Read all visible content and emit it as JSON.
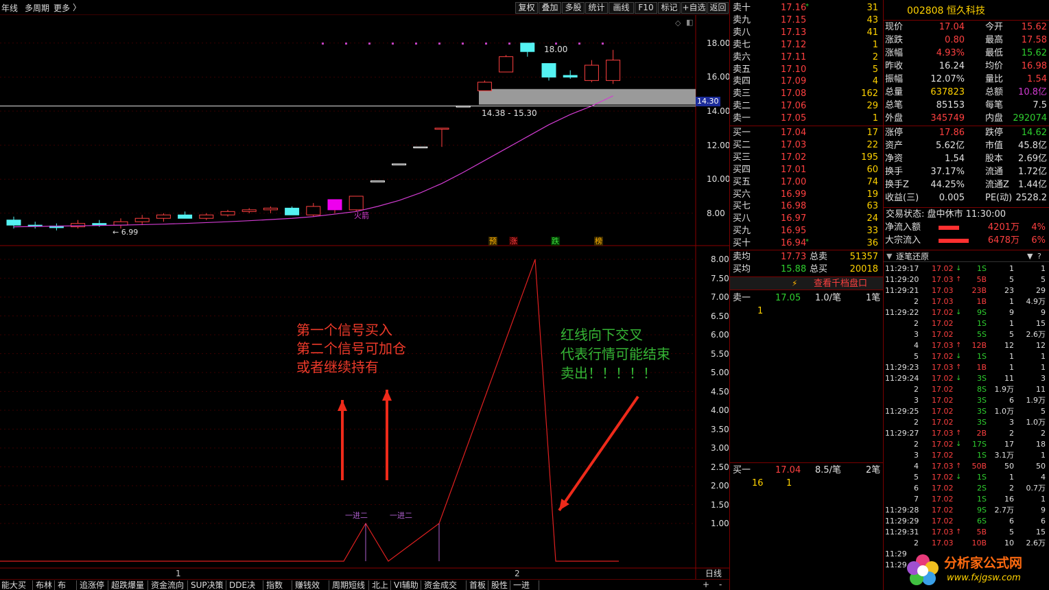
{
  "toolbar": {
    "period": "年线",
    "multi_period": "多周期",
    "more": "更多",
    "buttons": [
      "复权",
      "叠加",
      "多股",
      "统计",
      "画线",
      "F10",
      "标记",
      "+自选",
      "返回"
    ]
  },
  "stock": {
    "code_name": "002808 恒久科技"
  },
  "price_axis": [
    "18.00",
    "16.00",
    "14.00",
    "12.00",
    "10.00",
    "8.00"
  ],
  "current_price_tag": "14.30",
  "gap_band_label": "14.38 - 15.30",
  "candle_high_label": "18.00",
  "candle_low_label": "6.99",
  "candle_mark_label": "火箭",
  "badges": [
    "预",
    "涨",
    "跌",
    "榜"
  ],
  "indicator_axis": [
    "8.00",
    "7.50",
    "7.00",
    "6.50",
    "6.00",
    "5.50",
    "5.00",
    "4.50",
    "4.00",
    "3.50",
    "3.00",
    "2.50",
    "2.00",
    "1.50",
    "1.00"
  ],
  "signal_labels": [
    "一进二",
    "一进二"
  ],
  "annotation_red": [
    "第一个信号买入",
    "第二个信号可加仓",
    "或者继续持有"
  ],
  "annotation_green": [
    "红线向下交叉",
    "代表行情可能结束",
    "卖出！！！！！"
  ],
  "x_axis_labels": [
    "1",
    "2"
  ],
  "period_label": "日线",
  "zoom_plus": "+",
  "zoom_minus": "-",
  "bottom_tabs": [
    "能大买提",
    "布林",
    "布DE",
    "追涨停",
    "超跌爆量",
    "资金流向",
    "SUP决策",
    "DDE决策",
    "指数月",
    "赚钱效应",
    "周期短线",
    "北上",
    "VI辅助",
    "资金成交量",
    "首板",
    "股性",
    "一进二"
  ],
  "asks": [
    {
      "label": "卖十",
      "price": "17.16",
      "vol": "31",
      "mark": "*"
    },
    {
      "label": "卖九",
      "price": "17.15",
      "vol": "43"
    },
    {
      "label": "卖八",
      "price": "17.13",
      "vol": "41"
    },
    {
      "label": "卖七",
      "price": "17.12",
      "vol": "1"
    },
    {
      "label": "卖六",
      "price": "17.11",
      "vol": "2"
    },
    {
      "label": "卖五",
      "price": "17.10",
      "vol": "5"
    },
    {
      "label": "卖四",
      "price": "17.09",
      "vol": "4"
    },
    {
      "label": "卖三",
      "price": "17.08",
      "vol": "162"
    },
    {
      "label": "卖二",
      "price": "17.06",
      "vol": "29"
    },
    {
      "label": "卖一",
      "price": "17.05",
      "vol": "1"
    }
  ],
  "bids": [
    {
      "label": "买一",
      "price": "17.04",
      "vol": "17"
    },
    {
      "label": "买二",
      "price": "17.03",
      "vol": "22"
    },
    {
      "label": "买三",
      "price": "17.02",
      "vol": "195"
    },
    {
      "label": "买四",
      "price": "17.01",
      "vol": "60"
    },
    {
      "label": "买五",
      "price": "17.00",
      "vol": "74"
    },
    {
      "label": "买六",
      "price": "16.99",
      "vol": "19"
    },
    {
      "label": "买七",
      "price": "16.98",
      "vol": "63"
    },
    {
      "label": "买八",
      "price": "16.97",
      "vol": "24"
    },
    {
      "label": "买九",
      "price": "16.95",
      "vol": "33"
    },
    {
      "label": "买十",
      "price": "16.94",
      "vol": "36",
      "mark": "*"
    }
  ],
  "avg_rows": [
    {
      "label": "卖均",
      "price": "17.73",
      "label2": "总卖",
      "vol": "51357"
    },
    {
      "label": "买均",
      "price": "15.88",
      "label2": "总买",
      "vol": "20018"
    }
  ],
  "thousand_link": "查看千档盘口",
  "queue_sell": {
    "label": "卖一",
    "price": "17.05",
    "per": "1.0/笔",
    "count": "1笔",
    "orders": [
      "1"
    ]
  },
  "queue_buy": {
    "label": "买一",
    "price": "17.04",
    "per": "8.5/笔",
    "count": "2笔",
    "orders": [
      "16",
      "1"
    ]
  },
  "quote_rows": [
    [
      "现价",
      "17.04",
      "今开",
      "15.62"
    ],
    [
      "涨跌",
      "0.80",
      "最高",
      "17.58"
    ],
    [
      "涨幅",
      "4.93%",
      "最低",
      "15.62"
    ],
    [
      "昨收",
      "16.24",
      "均价",
      "16.98"
    ],
    [
      "振幅",
      "12.07%",
      "量比",
      "1.54"
    ],
    [
      "总量",
      "637823",
      "总额",
      "10.8亿"
    ],
    [
      "总笔",
      "85153",
      "每笔",
      "7.5"
    ],
    [
      "外盘",
      "345749",
      "内盘",
      "292074"
    ]
  ],
  "info_rows": [
    [
      "涨停",
      "17.86",
      "跌停",
      "14.62"
    ],
    [
      "资产",
      "5.62亿",
      "市值",
      "45.8亿"
    ],
    [
      "净资",
      "1.54",
      "股本",
      "2.69亿"
    ],
    [
      "换手",
      "37.17%",
      "流通",
      "1.72亿"
    ],
    [
      "换手Z",
      "44.25%",
      "流通Z",
      "1.44亿"
    ],
    [
      "收益(三)",
      "0.005",
      "PE(动)",
      "2528.2"
    ]
  ],
  "trade_status": "交易状态: 盘中休市 11:30:00",
  "flows": [
    {
      "label": "净流入额",
      "value": "4201万",
      "pct": "4%"
    },
    {
      "label": "大宗流入",
      "value": "6478万",
      "pct": "6%"
    }
  ],
  "ticks_title": "逐笔还原",
  "ticks": [
    [
      "11:29:17",
      "17.02",
      "d",
      "1S",
      "1",
      "1"
    ],
    [
      "11:29:20",
      "17.03",
      "u",
      "5B",
      "5",
      "5"
    ],
    [
      "11:29:21",
      "17.03",
      "",
      "23B",
      "23",
      "29"
    ],
    [
      "2",
      "17.03",
      "",
      "1B",
      "1",
      "4.9万"
    ],
    [
      "11:29:22",
      "17.02",
      "d",
      "9S",
      "9",
      "9"
    ],
    [
      "2",
      "17.02",
      "",
      "1S",
      "1",
      "15"
    ],
    [
      "3",
      "17.02",
      "",
      "5S",
      "5",
      "2.6万"
    ],
    [
      "4",
      "17.03",
      "u",
      "12B",
      "12",
      "12"
    ],
    [
      "5",
      "17.02",
      "d",
      "1S",
      "1",
      "1"
    ],
    [
      "11:29:23",
      "17.03",
      "u",
      "1B",
      "1",
      "1"
    ],
    [
      "11:29:24",
      "17.02",
      "d",
      "3S",
      "11",
      "3"
    ],
    [
      "2",
      "17.02",
      "",
      "8S",
      "1.9万",
      "11"
    ],
    [
      "3",
      "17.02",
      "",
      "3S",
      "6",
      "1.9万"
    ],
    [
      "11:29:25",
      "17.02",
      "",
      "3S",
      "1.0万",
      "5"
    ],
    [
      "2",
      "17.02",
      "",
      "3S",
      "3",
      "1.0万"
    ],
    [
      "11:29:27",
      "17.03",
      "u",
      "2B",
      "2",
      "2"
    ],
    [
      "2",
      "17.02",
      "d",
      "17S",
      "17",
      "18"
    ],
    [
      "3",
      "17.02",
      "",
      "1S",
      "3.1万",
      "1"
    ],
    [
      "4",
      "17.03",
      "u",
      "50B",
      "50",
      "50"
    ],
    [
      "5",
      "17.02",
      "d",
      "1S",
      "1",
      "4"
    ],
    [
      "6",
      "17.02",
      "",
      "2S",
      "2",
      "0.7万"
    ],
    [
      "7",
      "17.02",
      "",
      "1S",
      "16",
      "1"
    ],
    [
      "11:29:28",
      "17.02",
      "",
      "9S",
      "2.7万",
      "9"
    ],
    [
      "11:29:29",
      "17.02",
      "",
      "6S",
      "6",
      "6"
    ],
    [
      "11:29:31",
      "17.03",
      "u",
      "5B",
      "5",
      "15"
    ],
    [
      "2",
      "17.03",
      "",
      "10B",
      "10",
      "2.6万"
    ],
    [
      "11:29",
      "",
      "",
      "",
      "",
      ""
    ],
    [
      "11:29",
      "",
      "",
      "",
      "",
      ""
    ]
  ],
  "watermark": {
    "title": "分析家公式网",
    "url": "www.fxjgsw.com"
  },
  "chart_data": {
    "type": "line",
    "indicator": {
      "x": [
        0,
        1,
        2,
        3,
        4,
        5,
        6,
        7,
        8,
        9,
        10,
        11,
        12,
        13,
        14
      ],
      "values": [
        0,
        0,
        0,
        0,
        0,
        0,
        0,
        1,
        0,
        1,
        4,
        8,
        0,
        0,
        0
      ],
      "ylim": [
        0,
        8
      ],
      "signals": [
        7,
        9
      ]
    },
    "candles": {
      "ylim": [
        6.5,
        19
      ],
      "ohlc": [
        [
          7.6,
          7.8,
          7.1,
          7.3
        ],
        [
          7.3,
          7.5,
          7.1,
          7.25
        ],
        [
          7.25,
          7.4,
          6.99,
          7.15
        ],
        [
          7.2,
          7.6,
          7.1,
          7.4
        ],
        [
          7.4,
          7.6,
          7.2,
          7.3
        ],
        [
          7.3,
          7.7,
          7.1,
          7.5
        ],
        [
          7.5,
          7.9,
          7.3,
          7.7
        ],
        [
          7.7,
          8.0,
          7.5,
          7.9
        ],
        [
          7.9,
          8.1,
          7.7,
          7.7
        ],
        [
          7.7,
          8.0,
          7.6,
          7.9
        ],
        [
          7.9,
          8.2,
          7.8,
          8.1
        ],
        [
          8.1,
          8.3,
          8.0,
          8.2
        ],
        [
          8.2,
          8.4,
          8.0,
          8.3
        ],
        [
          8.3,
          8.4,
          8.1,
          7.9
        ],
        [
          7.9,
          8.6,
          7.8,
          8.4
        ],
        [
          8.2,
          8.8,
          8.0,
          8.8
        ],
        [
          8.2,
          9.0,
          8.1,
          9.0
        ],
        [
          9.9,
          9.9,
          9.9,
          9.9
        ],
        [
          10.9,
          10.9,
          10.9,
          10.9
        ],
        [
          11.9,
          11.9,
          11.9,
          11.9
        ],
        [
          13.0,
          13.0,
          11.9,
          13.0
        ],
        [
          14.3,
          14.3,
          14.3,
          14.3
        ],
        [
          15.2,
          15.8,
          15.2,
          15.7
        ],
        [
          16.3,
          17.3,
          16.3,
          17.2
        ],
        [
          18.0,
          18.0,
          17.2,
          17.5
        ],
        [
          16.8,
          16.8,
          15.8,
          16.0
        ],
        [
          16.1,
          16.4,
          15.9,
          16.0
        ],
        [
          15.8,
          17.0,
          15.7,
          16.7
        ],
        [
          15.8,
          17.6,
          15.6,
          17.0
        ]
      ],
      "ma": [
        7.2,
        7.22,
        7.24,
        7.26,
        7.28,
        7.3,
        7.33,
        7.36,
        7.4,
        7.45,
        7.5,
        7.56,
        7.63,
        7.7,
        7.8,
        7.95,
        8.1,
        8.4,
        8.75,
        9.2,
        9.75,
        10.4,
        11.1,
        11.8,
        12.5,
        13.2,
        13.8,
        14.3,
        14.9
      ],
      "gap_band": [
        14.38,
        15.3
      ]
    }
  }
}
